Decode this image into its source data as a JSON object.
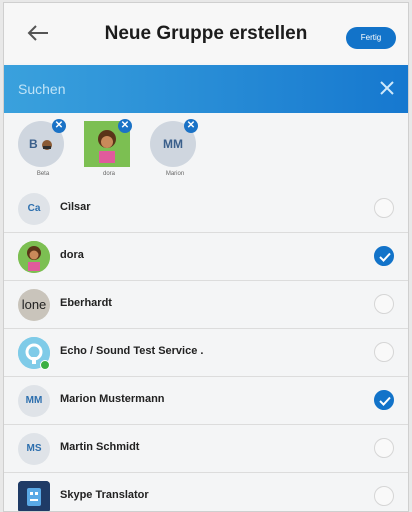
{
  "header": {
    "title": "Neue Gruppe erstellen",
    "done_label": "Fertig"
  },
  "search": {
    "placeholder": "Suchen"
  },
  "selected_chips": [
    {
      "initials": "B",
      "label": "Beta"
    },
    {
      "initials": "",
      "label": "dora"
    },
    {
      "initials": "MM",
      "label": "Marion"
    }
  ],
  "contacts": [
    {
      "initials": "Ca",
      "name": "Cìlsar",
      "selected": false
    },
    {
      "initials": "",
      "name": "dora",
      "selected": true
    },
    {
      "initials": "lone",
      "name": "Eberhardt",
      "selected": false
    },
    {
      "initials": "",
      "name": "Echo / Sound Test Service .",
      "selected": false
    },
    {
      "initials": "MM",
      "name": "Marion Mustermann",
      "selected": true
    },
    {
      "initials": "MS",
      "name": "Martin Schmidt",
      "selected": false
    },
    {
      "initials": "",
      "name": "Skype Translator",
      "selected": false
    }
  ],
  "colors": {
    "accent": "#1273c9",
    "search_bar": "#2b8fd6",
    "online": "#3cb043"
  }
}
